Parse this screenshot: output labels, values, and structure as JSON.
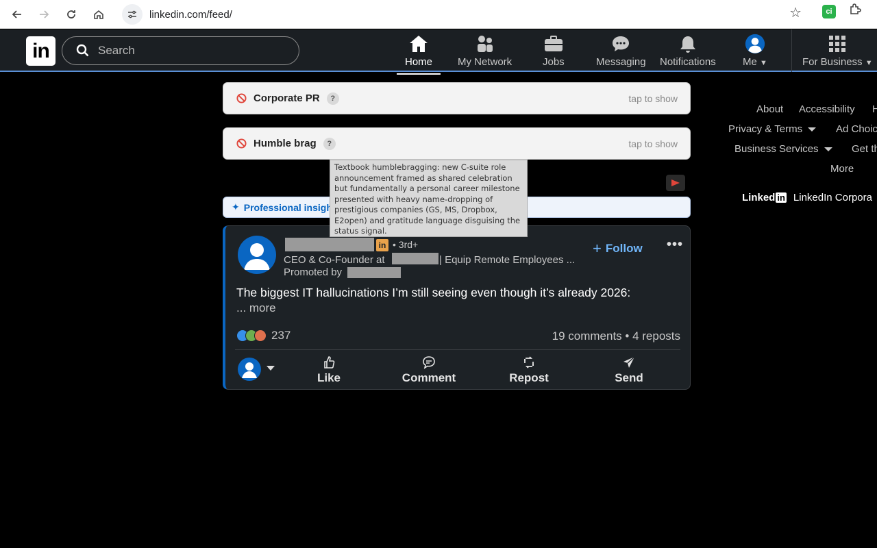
{
  "browser": {
    "url": "linkedin.com/feed/"
  },
  "header": {
    "logo": "in",
    "search_placeholder": "Search",
    "nav": [
      {
        "label": "Home"
      },
      {
        "label": "My Network"
      },
      {
        "label": "Jobs"
      },
      {
        "label": "Messaging"
      },
      {
        "label": "Notifications"
      },
      {
        "label": "Me"
      },
      {
        "label": "For Business"
      }
    ]
  },
  "filters": [
    {
      "label": "Corporate PR",
      "help": "?",
      "action": "tap to show"
    },
    {
      "label": "Humble brag",
      "help": "?",
      "action": "tap to show"
    }
  ],
  "tooltip": {
    "text": "Textbook humblebragging: new C-suite role announcement framed as shared celebration but fundamentally a personal career milestone presented with heavy name-dropping of prestigious companies (GS, MS, Dropbox, E2open) and gratitude language disguising the status signal."
  },
  "insight": {
    "label": "Professional insigh"
  },
  "post": {
    "badge": "in",
    "degree": "• 3rd+",
    "headline_prefix": "CEO & Co-Founder at",
    "headline_suffix": "| Equip Remote Employees ...",
    "promoted": "Promoted by",
    "follow": "Follow",
    "more_menu": "•••",
    "body": "The biggest IT hallucinations I’m still seeing even though it’s already 2026:",
    "more": "... more",
    "reaction_count": "237",
    "stats": "19 comments • 4 reposts",
    "actions": [
      {
        "label": "Like"
      },
      {
        "label": "Comment"
      },
      {
        "label": "Repost"
      },
      {
        "label": "Send"
      }
    ]
  },
  "footer": {
    "links": [
      "About",
      "Accessibility",
      "H",
      "Privacy & Terms",
      "Ad Choic",
      "Business Services",
      "Get th",
      "More"
    ],
    "brand": "Linked",
    "brand_in": "in",
    "corp": "LinkedIn Corpora"
  },
  "colors": {
    "accent": "#0a66c2",
    "follow": "#71b7fb"
  }
}
